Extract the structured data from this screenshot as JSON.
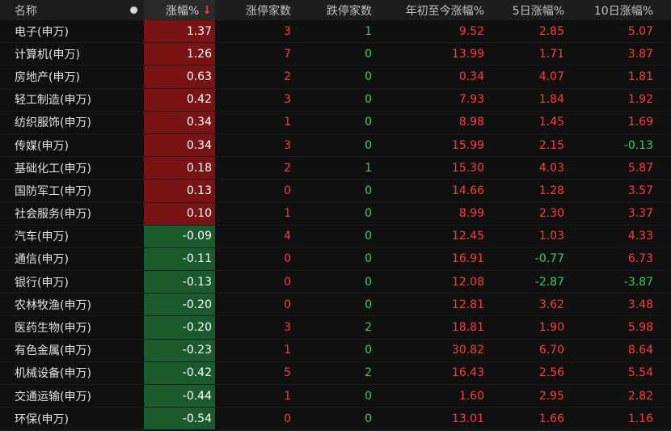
{
  "header": {
    "name": "名称",
    "change_pct": "涨幅%",
    "sort_arrow": "↓",
    "limit_up_count": "涨停家数",
    "limit_down_count": "跌停家数",
    "ytd_change": "年初至今涨幅%",
    "d5_change": "5日涨幅%",
    "d10_change": "10日涨幅%"
  },
  "colors": {
    "up": "#ff3a3a",
    "down": "#2ed15a",
    "up_bg": "#7a1315",
    "down_bg": "#1b5a2d"
  },
  "rows": [
    {
      "name": "电子(申万)",
      "chg": "1.37",
      "up": "3",
      "dn": "1",
      "ytd": "9.52",
      "d5": "2.85",
      "d10": "5.07"
    },
    {
      "name": "计算机(申万)",
      "chg": "1.26",
      "up": "7",
      "dn": "0",
      "ytd": "13.99",
      "d5": "1.71",
      "d10": "3.87"
    },
    {
      "name": "房地产(申万)",
      "chg": "0.63",
      "up": "2",
      "dn": "0",
      "ytd": "0.34",
      "d5": "4.07",
      "d10": "1.81"
    },
    {
      "name": "轻工制造(申万)",
      "chg": "0.42",
      "up": "3",
      "dn": "0",
      "ytd": "7.93",
      "d5": "1.84",
      "d10": "1.92"
    },
    {
      "name": "纺织服饰(申万)",
      "chg": "0.34",
      "up": "1",
      "dn": "0",
      "ytd": "8.98",
      "d5": "1.45",
      "d10": "1.69"
    },
    {
      "name": "传媒(申万)",
      "chg": "0.34",
      "up": "3",
      "dn": "0",
      "ytd": "15.99",
      "d5": "2.15",
      "d10": "-0.13"
    },
    {
      "name": "基础化工(申万)",
      "chg": "0.18",
      "up": "2",
      "dn": "1",
      "ytd": "15.30",
      "d5": "4.03",
      "d10": "5.87"
    },
    {
      "name": "国防军工(申万)",
      "chg": "0.13",
      "up": "0",
      "dn": "0",
      "ytd": "14.66",
      "d5": "1.28",
      "d10": "3.57"
    },
    {
      "name": "社会服务(申万)",
      "chg": "0.10",
      "up": "1",
      "dn": "0",
      "ytd": "8.99",
      "d5": "2.30",
      "d10": "3.37"
    },
    {
      "name": "汽车(申万)",
      "chg": "-0.09",
      "up": "4",
      "dn": "0",
      "ytd": "12.45",
      "d5": "1.03",
      "d10": "4.33"
    },
    {
      "name": "通信(申万)",
      "chg": "-0.11",
      "up": "0",
      "dn": "0",
      "ytd": "16.91",
      "d5": "-0.77",
      "d10": "6.73"
    },
    {
      "name": "银行(申万)",
      "chg": "-0.13",
      "up": "0",
      "dn": "0",
      "ytd": "12.08",
      "d5": "-2.87",
      "d10": "-3.87"
    },
    {
      "name": "农林牧渔(申万)",
      "chg": "-0.20",
      "up": "0",
      "dn": "0",
      "ytd": "12.81",
      "d5": "3.62",
      "d10": "3.48"
    },
    {
      "name": "医药生物(申万)",
      "chg": "-0.20",
      "up": "3",
      "dn": "2",
      "ytd": "18.81",
      "d5": "1.90",
      "d10": "5.98"
    },
    {
      "name": "有色金属(申万)",
      "chg": "-0.23",
      "up": "1",
      "dn": "0",
      "ytd": "30.82",
      "d5": "6.70",
      "d10": "8.64"
    },
    {
      "name": "机械设备(申万)",
      "chg": "-0.42",
      "up": "5",
      "dn": "2",
      "ytd": "16.43",
      "d5": "2.56",
      "d10": "5.54"
    },
    {
      "name": "交通运输(申万)",
      "chg": "-0.44",
      "up": "1",
      "dn": "0",
      "ytd": "1.60",
      "d5": "2.95",
      "d10": "2.82"
    },
    {
      "name": "环保(申万)",
      "chg": "-0.54",
      "up": "0",
      "dn": "0",
      "ytd": "13.01",
      "d5": "1.66",
      "d10": "1.16"
    }
  ]
}
